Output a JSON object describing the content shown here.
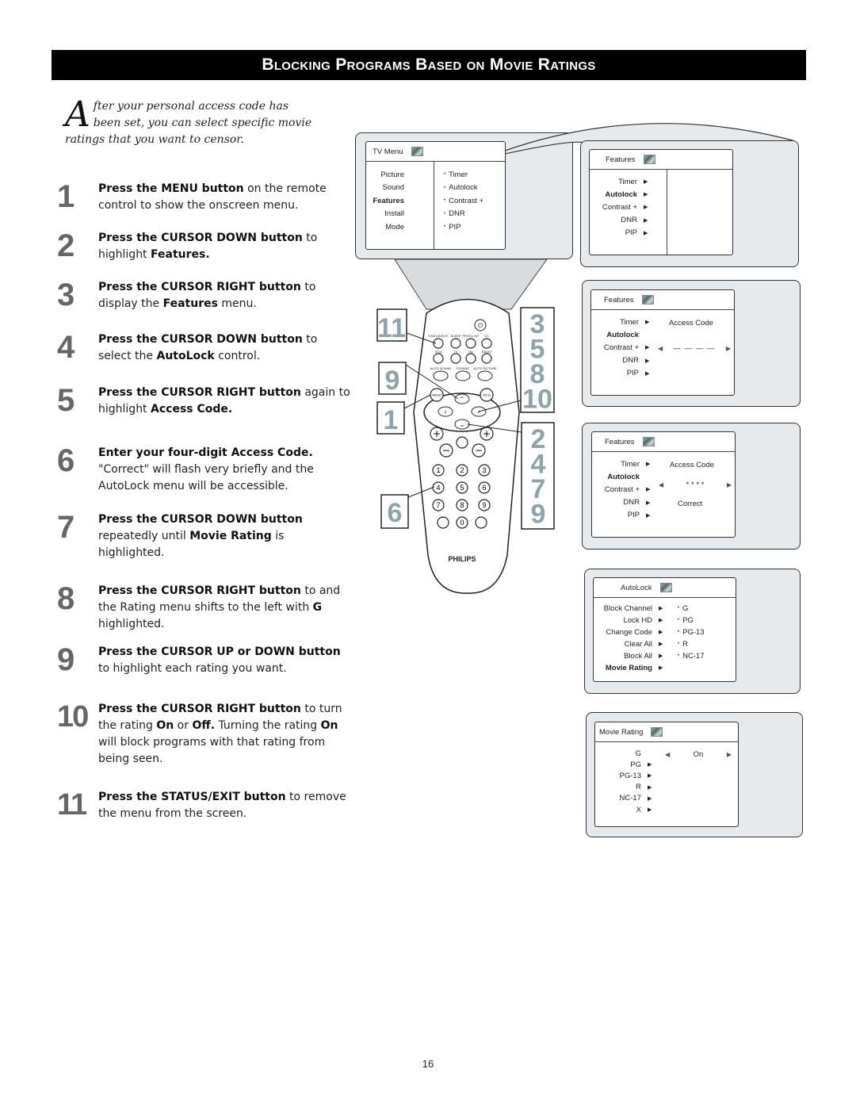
{
  "header": {
    "title": "Blocking Programs Based on Movie Ratings"
  },
  "intro": {
    "dropcap": "A",
    "text": "fter your personal access code has been set, you can select specific movie ratings that you want to censor."
  },
  "steps": [
    {
      "num": "1",
      "bold": "Press the MENU button",
      "rest": " on the remote control to show the onscreen menu."
    },
    {
      "num": "2",
      "bold": "Press the CURSOR DOWN button",
      "rest": " to highlight ",
      "bold2": "Features."
    },
    {
      "num": "3",
      "bold": "Press the CURSOR RIGHT button",
      "rest": " to display the ",
      "bold2": "Features",
      "rest2": " menu."
    },
    {
      "num": "4",
      "bold": "Press the CURSOR DOWN button",
      "rest": " to select the ",
      "bold2": "AutoLock",
      "rest2": "  control."
    },
    {
      "num": "5",
      "bold": "Press the CURSOR RIGHT button",
      "rest": " again to highlight ",
      "bold2": "Access Code."
    },
    {
      "num": "6",
      "bold": "Enter your four-digit Access Code.",
      "rest": " \"Correct\" will flash very briefly and the AutoLock menu will be accessible."
    },
    {
      "num": "7",
      "bold": "Press the CURSOR DOWN button",
      "rest": " repeatedly until ",
      "bold2": "Movie Rating",
      "rest2": " is highlighted."
    },
    {
      "num": "8",
      "bold": "Press the CURSOR RIGHT button",
      "rest": " to and the Rating menu shifts to the left with ",
      "bold2": "G",
      "rest2": " highlighted."
    },
    {
      "num": "9",
      "bold": "Press the CURSOR UP or DOWN button",
      "rest": " to highlight each rating you want."
    },
    {
      "num": "10",
      "bold": "Press the CURSOR RIGHT button",
      "rest": " to turn the rating ",
      "bold2": "On",
      "rest2": " or ",
      "bold3": "Off.",
      "rest3": "  Turning the rating ",
      "bold4": "On",
      "rest4": " will block programs with that rating from being seen."
    },
    {
      "num": "11",
      "bold": "Press the STATUS/EXIT button",
      "rest": " to remove the menu from the screen."
    }
  ],
  "tv_menu": {
    "title": "TV Menu",
    "left_items": [
      "Picture",
      "Sound",
      "Features",
      "Install",
      "Mode"
    ],
    "highlighted": "Features",
    "right_items": [
      "Timer",
      "Autolock",
      "Contrast +",
      "DNR",
      "PIP"
    ]
  },
  "features_menu_1": {
    "title": "Features",
    "items": [
      "Timer",
      "Autolock",
      "Contrast +",
      "DNR",
      "PIP"
    ],
    "highlighted": "Autolock"
  },
  "features_menu_2": {
    "title": "Features",
    "items": [
      "Timer",
      "Autolock",
      "Contrast +",
      "DNR",
      "PIP"
    ],
    "highlighted": "Autolock",
    "access_label": "Access Code",
    "code_value": "— — — —"
  },
  "features_menu_3": {
    "title": "Features",
    "items": [
      "Timer",
      "Autolock",
      "Contrast +",
      "DNR",
      "PIP"
    ],
    "highlighted": "Autolock",
    "access_label": "Access Code",
    "code_value": "* * * *",
    "status": "Correct"
  },
  "autolock_menu": {
    "title": "AutoLock",
    "items": [
      "Block Channel",
      "Lock HD",
      "Change Code",
      "Clear All",
      "Block All",
      "Movie Rating"
    ],
    "highlighted": "Movie Rating",
    "ratings": [
      "G",
      "PG",
      "PG-13",
      "R",
      "NC-17"
    ]
  },
  "movie_rating_menu": {
    "title": "Movie Rating",
    "items": [
      "G",
      "PG",
      "PG-13",
      "R",
      "NC-17",
      "X"
    ],
    "selected": "G",
    "value": "On"
  },
  "remote": {
    "brand": "PHILIPS",
    "top_labels": [
      "STATUS/EXIT",
      "SLEEP",
      "PROG.LIST",
      "CC"
    ],
    "row2_labels": [
      "VGA",
      "TV",
      "HD",
      "RADIO"
    ],
    "row3_labels": [
      "AUTO SOUND",
      "FORMAT",
      "AUTO PICTURE"
    ],
    "menu_label": "MENU",
    "ach_label": "A/CH",
    "keypad": [
      "1",
      "2",
      "3",
      "4",
      "5",
      "6",
      "7",
      "8",
      "9",
      "0"
    ],
    "callouts": {
      "c11": "11",
      "c9": "9",
      "c1": "1",
      "c6": "6",
      "right_top": [
        "3",
        "5",
        "8",
        "10"
      ],
      "right_bottom": [
        "2",
        "4",
        "7",
        "9"
      ]
    }
  },
  "page_number": "16"
}
